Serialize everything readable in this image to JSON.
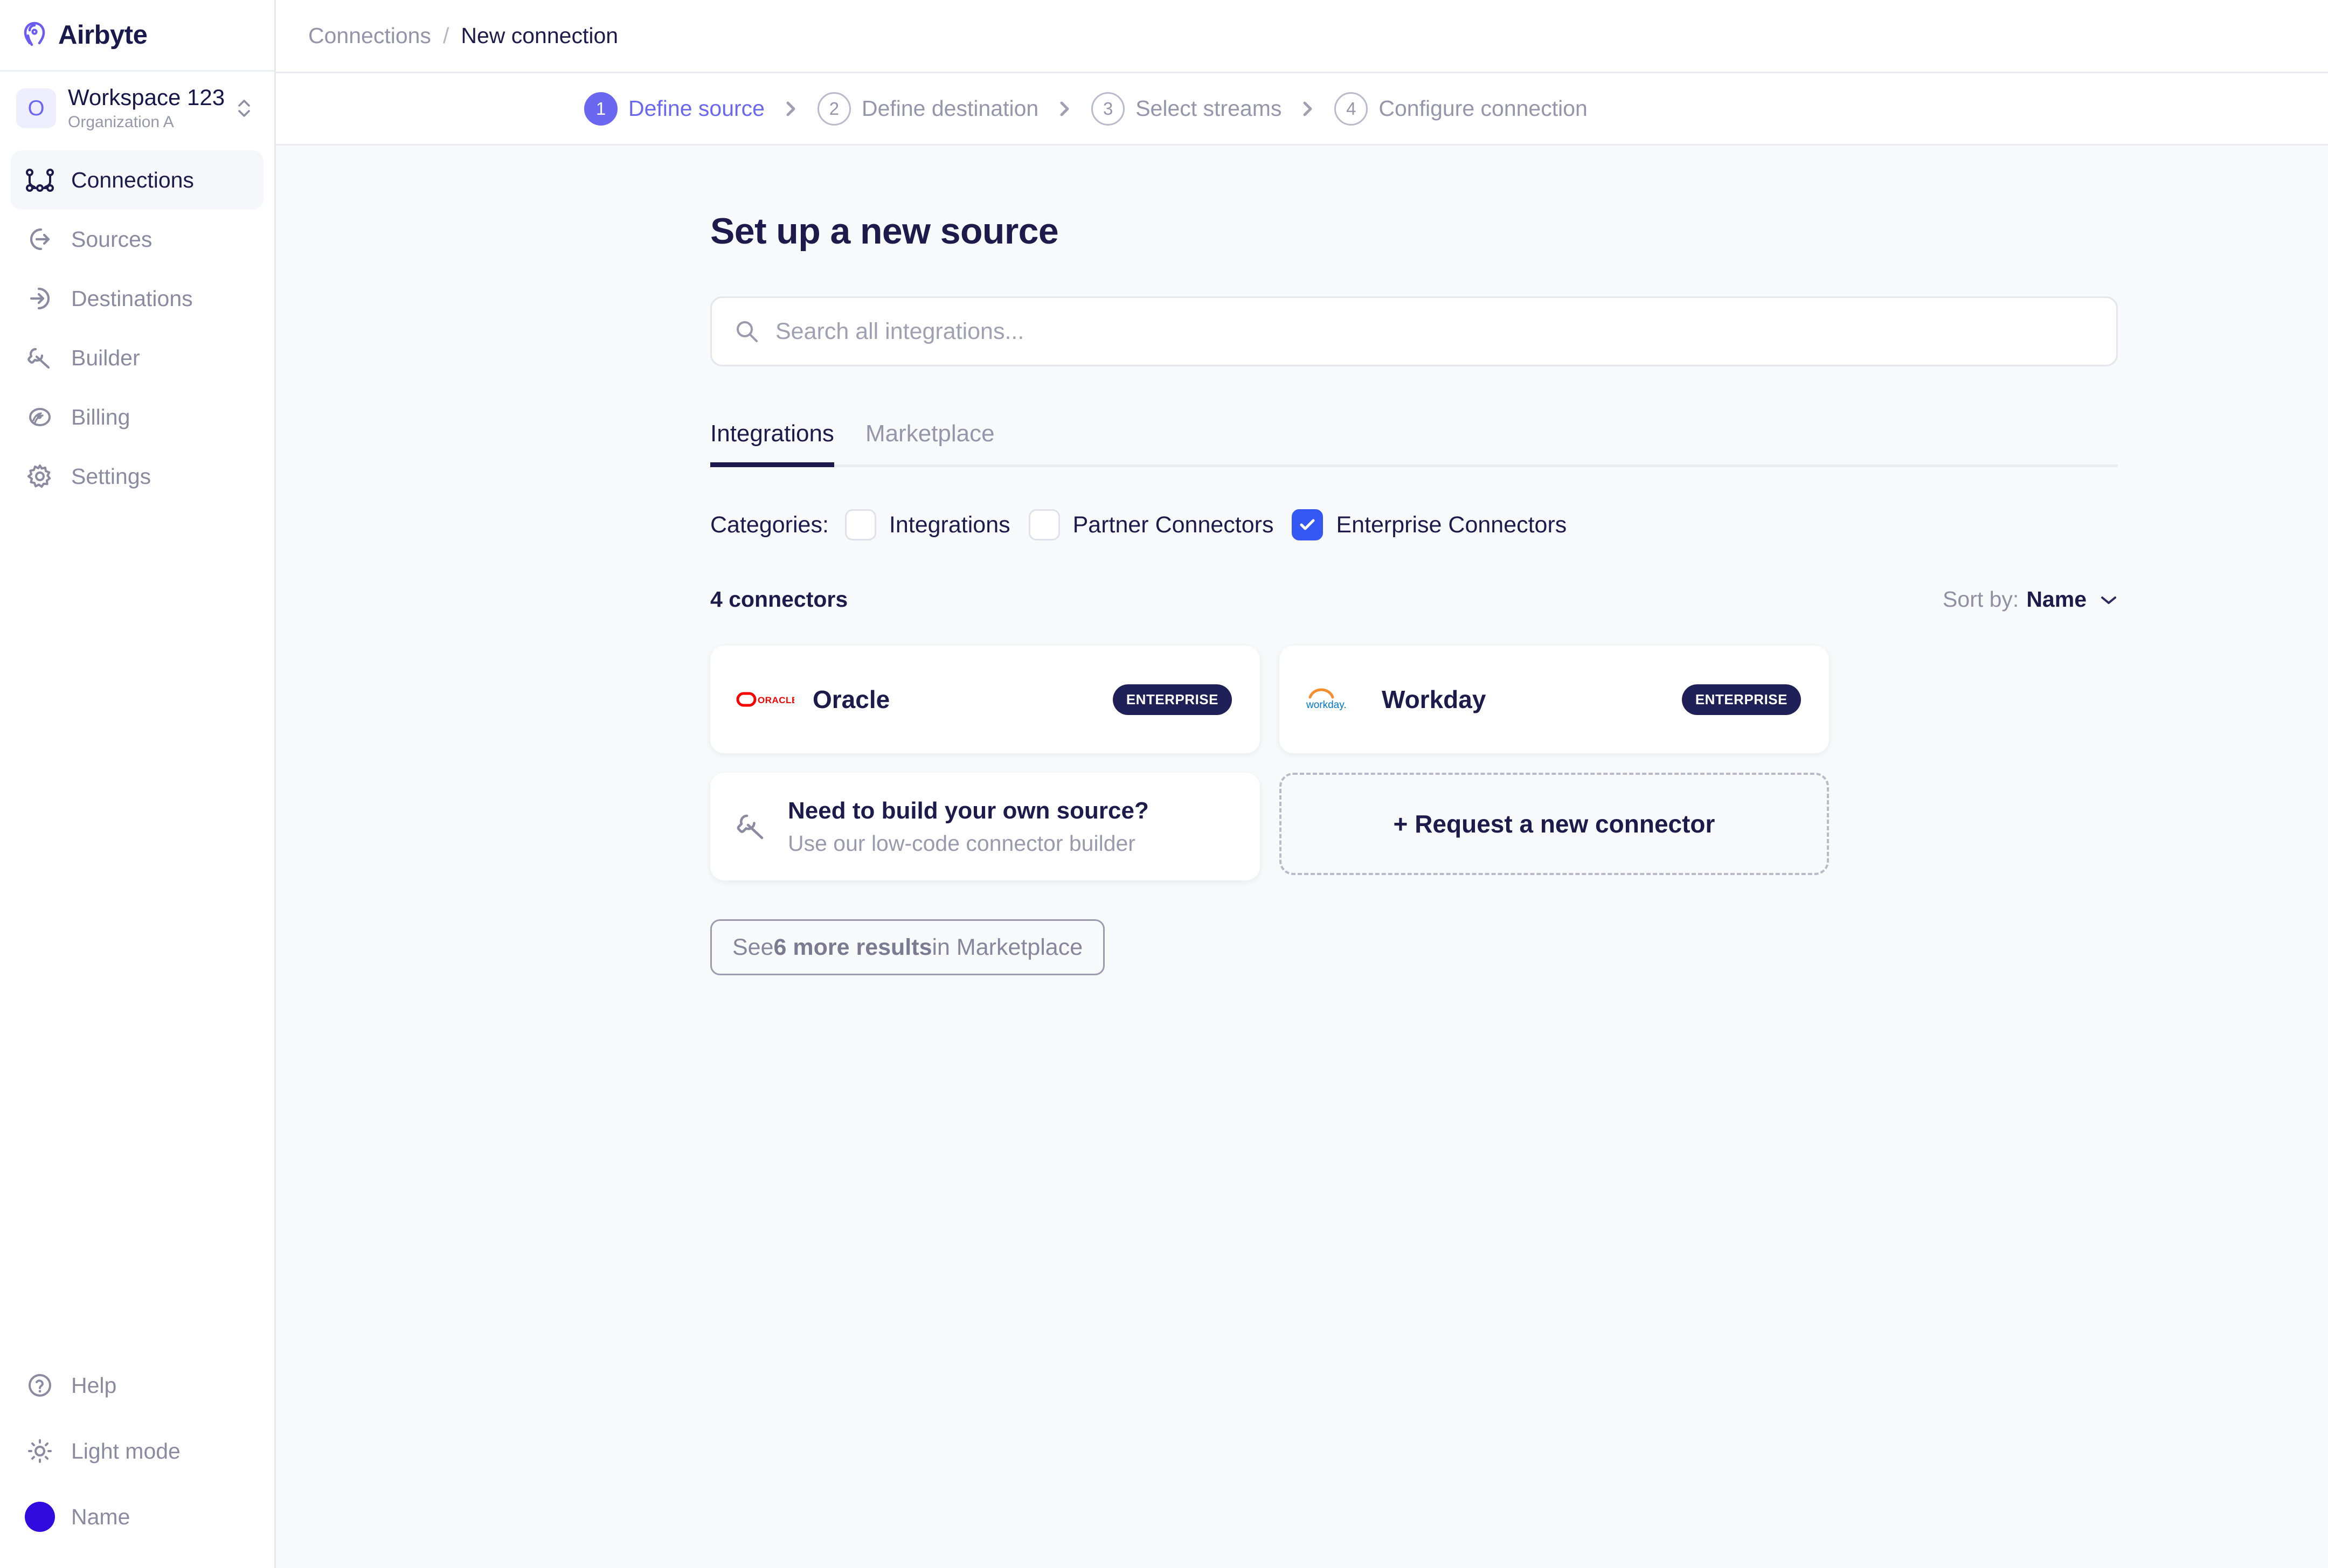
{
  "sidebar": {
    "brand": {
      "name": "Airbyte",
      "logo_icon": "airbyte-logo-icon"
    },
    "workspace": {
      "initial": "O",
      "name": "Workspace 123",
      "organization": "Organization A",
      "switcher_icon": "chevron-up-down-icon"
    },
    "nav_items": [
      {
        "label": "Connections",
        "icon": "connections-icon",
        "active": true
      },
      {
        "label": "Sources",
        "icon": "sources-arrow-out-icon",
        "active": false
      },
      {
        "label": "Destinations",
        "icon": "destinations-arrow-in-icon",
        "active": false
      },
      {
        "label": "Builder",
        "icon": "wrench-icon",
        "active": false
      },
      {
        "label": "Billing",
        "icon": "billing-icon",
        "active": false
      },
      {
        "label": "Settings",
        "icon": "gear-icon",
        "active": false
      }
    ],
    "bottom_items": [
      {
        "label": "Help",
        "icon": "question-circle-icon"
      },
      {
        "label": "Light mode",
        "icon": "sun-icon"
      },
      {
        "label": "Name",
        "icon": "user-avatar"
      }
    ]
  },
  "breadcrumb": {
    "parent": "Connections",
    "separator": "/",
    "current": "New connection"
  },
  "stepper": {
    "steps": [
      {
        "number": "1",
        "label": "Define source",
        "active": true
      },
      {
        "number": "2",
        "label": "Define destination",
        "active": false
      },
      {
        "number": "3",
        "label": "Select streams",
        "active": false
      },
      {
        "number": "4",
        "label": "Configure connection",
        "active": false
      }
    ]
  },
  "main": {
    "title": "Set up a new source",
    "search": {
      "placeholder": "Search all integrations...",
      "value": "",
      "icon": "search-icon"
    },
    "tabs": [
      {
        "label": "Integrations",
        "active": true
      },
      {
        "label": "Marketplace",
        "active": false
      }
    ],
    "categories": {
      "label": "Categories:",
      "options": [
        {
          "label": "Integrations",
          "checked": false
        },
        {
          "label": "Partner Connectors",
          "checked": false
        },
        {
          "label": "Enterprise Connectors",
          "checked": true
        }
      ]
    },
    "results": {
      "count_text": "4 connectors",
      "sort_label": "Sort by:",
      "sort_value": "Name",
      "sort_chevron_icon": "chevron-down-icon"
    },
    "connectors": [
      {
        "name": "Oracle",
        "badge": "ENTERPRISE",
        "logo_icon": "oracle-logo-icon"
      },
      {
        "name": "Workday",
        "badge": "ENTERPRISE",
        "logo_icon": "workday-logo-icon"
      }
    ],
    "builder_card": {
      "title": "Need to build your own source?",
      "subtitle": "Use our low-code connector builder",
      "icon": "wrench-icon"
    },
    "request_card": {
      "label": "+ Request a new connector"
    },
    "see_more": {
      "prefix": "See ",
      "highlight": "6 more results",
      "suffix": " in Marketplace"
    }
  },
  "colors": {
    "brand_indigo": "#6a67f0",
    "checkbox_blue": "#3558f4",
    "dark_navy": "#1c1b4b",
    "muted_text": "#9596ab",
    "avatar_blue": "#2f0bdf",
    "page_bg": "#f8f9fb",
    "oracle_red": "#f80000",
    "workday_orange": "#f68d2e",
    "workday_blue": "#0075c9"
  }
}
